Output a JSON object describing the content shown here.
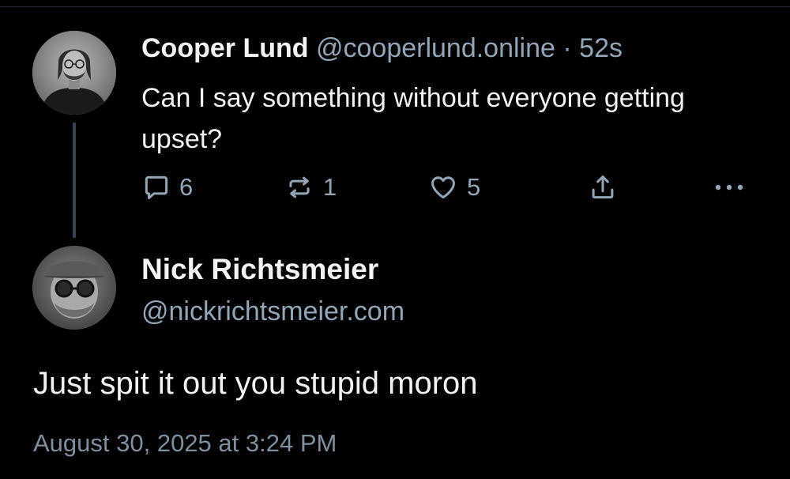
{
  "colors": {
    "background": "#000000",
    "primary_text": "#f1f3f5",
    "secondary_text": "#93a5b7",
    "thread_line": "#3c4451"
  },
  "parent_post": {
    "author_name": "Cooper Lund",
    "handle": "@cooperlund.online",
    "separator": "·",
    "time_ago": "52s",
    "text": "Can I say something without everyone getting upset?",
    "avatar_icon": "avatar-photo-icon",
    "actions": {
      "reply_count": "6",
      "repost_count": "1",
      "like_count": "5",
      "reply_icon": "speech-bubble-icon",
      "repost_icon": "repost-arrows-icon",
      "like_icon": "heart-icon",
      "share_icon": "share-upload-icon",
      "more_icon": "more-dots-icon"
    }
  },
  "reply_post": {
    "author_name": "Nick Richtsmeier",
    "handle": "@nickrichtsmeier.com",
    "text": "Just spit it out you stupid moron",
    "timestamp": "August 30, 2025 at 3:24 PM",
    "avatar_icon": "avatar-photo-icon"
  }
}
